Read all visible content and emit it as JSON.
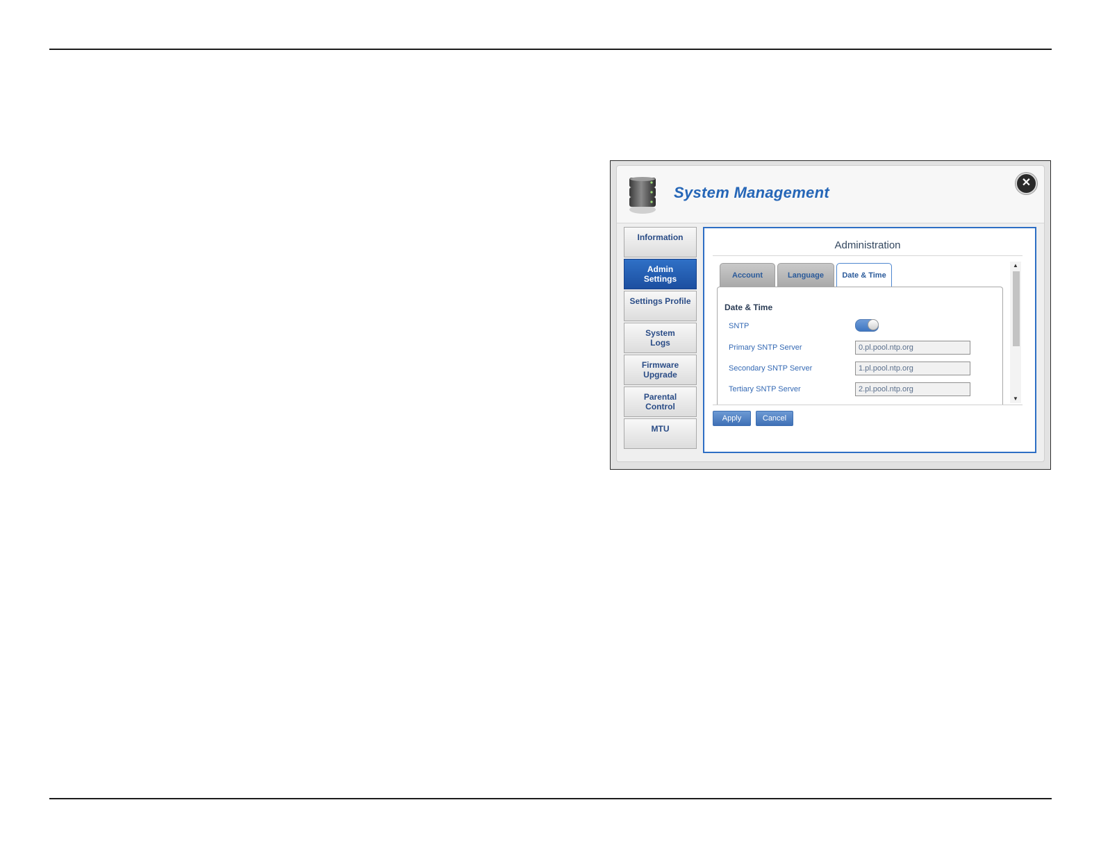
{
  "window": {
    "title": "System Management",
    "close_icon": "close-icon"
  },
  "sidebar": {
    "items": [
      {
        "label": "Information",
        "active": false
      },
      {
        "label": "Admin\nSettings",
        "active": true
      },
      {
        "label": "Settings Profile",
        "active": false
      },
      {
        "label": "System\nLogs",
        "active": false
      },
      {
        "label": "Firmware\nUpgrade",
        "active": false
      },
      {
        "label": "Parental\nControl",
        "active": false
      },
      {
        "label": "MTU",
        "active": false
      }
    ]
  },
  "content": {
    "title": "Administration",
    "tabs": [
      {
        "label": "Account",
        "active": false
      },
      {
        "label": "Language",
        "active": false
      },
      {
        "label": "Date & Time",
        "active": true
      }
    ],
    "section_title": "Date & Time",
    "fields": {
      "sntp": {
        "label": "SNTP",
        "enabled": true
      },
      "primary": {
        "label": "Primary SNTP Server",
        "value": "0.pl.pool.ntp.org"
      },
      "secondary": {
        "label": "Secondary SNTP Server",
        "value": "1.pl.pool.ntp.org"
      },
      "tertiary": {
        "label": "Tertiary SNTP Server",
        "value": "2.pl.pool.ntp.org"
      }
    },
    "buttons": {
      "apply": "Apply",
      "cancel": "Cancel"
    }
  },
  "colors": {
    "accent": "#2d6ec4",
    "title": "#2566b7",
    "active_nav": "#1c4fa0"
  }
}
